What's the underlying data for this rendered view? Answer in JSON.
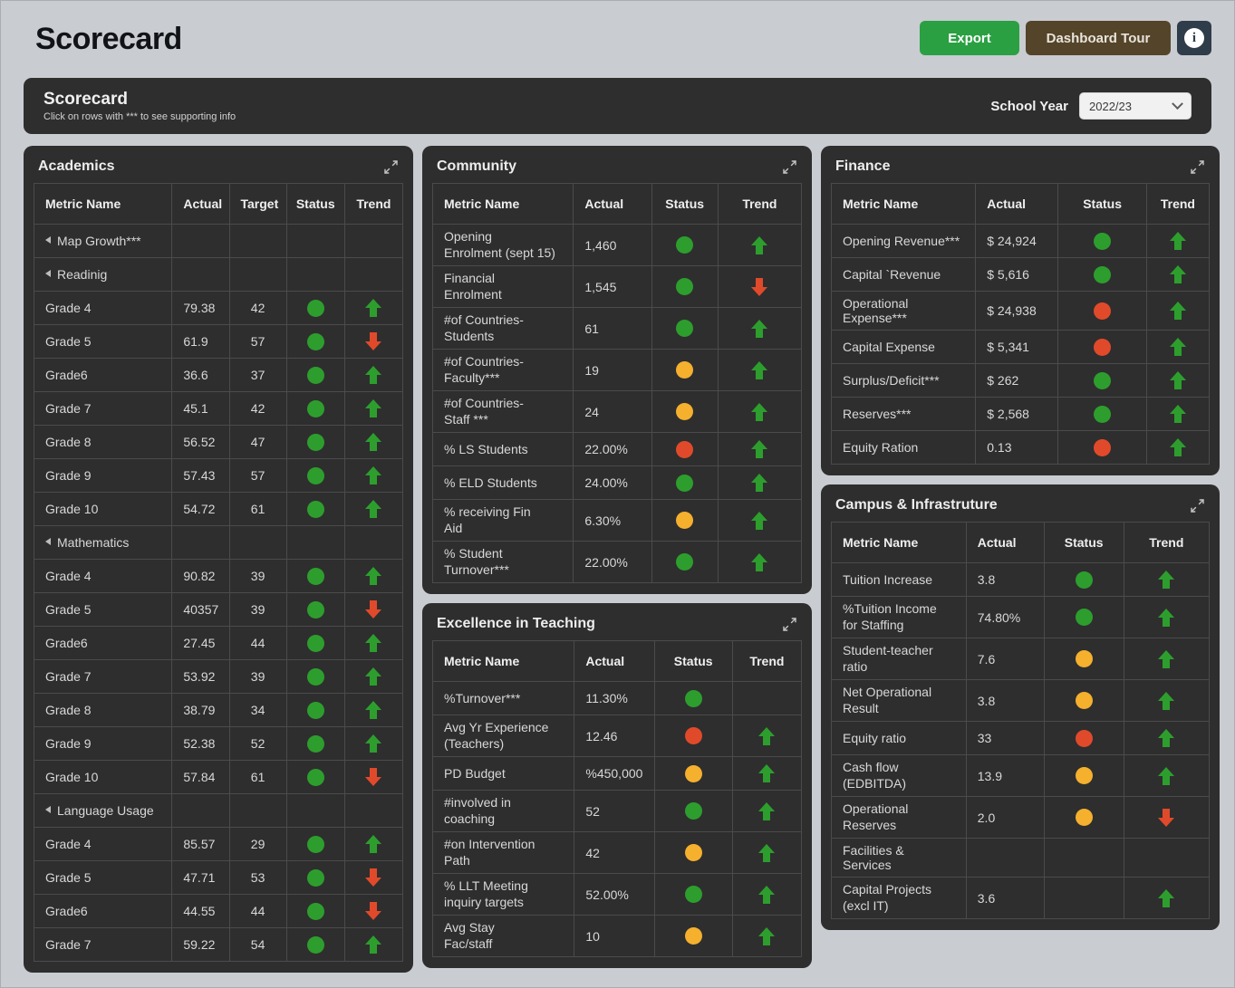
{
  "header": {
    "title": "Scorecard",
    "export_label": "Export",
    "tour_label": "Dashboard Tour",
    "info_icon": "info-icon",
    "info_glyph": "i"
  },
  "band": {
    "title": "Scorecard",
    "subtitle": "Click on rows with *** to see supporting info",
    "school_year_label": "School Year",
    "school_year_value": "2022/23",
    "chevron_icon": "chevron-down-icon"
  },
  "colors": {
    "green": "#2d9e2d",
    "amber": "#f5b02e",
    "red": "#e04a2a",
    "export_button": "#2aa042",
    "tour_button": "#54442a",
    "info_button": "#2f3c4a",
    "panel_bg": "#2e2e2e",
    "page_bg": "#c9ccd1"
  },
  "panels": {
    "academics": {
      "title": "Academics",
      "expand_icon": "expand-icon",
      "columns": [
        "Metric Name",
        "Actual",
        "Target",
        "Status",
        "Trend"
      ],
      "rows": [
        {
          "name": "Map Growth***",
          "level": 1,
          "group": true,
          "actual": "",
          "target": "",
          "status": "",
          "trend": ""
        },
        {
          "name": "Readinig",
          "level": 2,
          "group": true,
          "actual": "",
          "target": "",
          "status": "",
          "trend": ""
        },
        {
          "name": "Grade 4",
          "level": 3,
          "actual": "79.38",
          "target": "42",
          "status": "green",
          "trend": "up"
        },
        {
          "name": "Grade 5",
          "level": 3,
          "actual": "61.9",
          "target": "57",
          "status": "green",
          "trend": "down"
        },
        {
          "name": "Grade6",
          "level": 3,
          "actual": "36.6",
          "target": "37",
          "status": "green",
          "trend": "up"
        },
        {
          "name": "Grade 7",
          "level": 3,
          "actual": "45.1",
          "target": "42",
          "status": "green",
          "trend": "up"
        },
        {
          "name": "Grade 8",
          "level": 3,
          "actual": "56.52",
          "target": "47",
          "status": "green",
          "trend": "up"
        },
        {
          "name": "Grade 9",
          "level": 3,
          "actual": "57.43",
          "target": "57",
          "status": "green",
          "trend": "up"
        },
        {
          "name": "Grade 10",
          "level": 3,
          "actual": "54.72",
          "target": "61",
          "status": "green",
          "trend": "up"
        },
        {
          "name": "Mathematics",
          "level": 2,
          "group": true,
          "actual": "",
          "target": "",
          "status": "",
          "trend": ""
        },
        {
          "name": "Grade 4",
          "level": 3,
          "actual": "90.82",
          "target": "39",
          "status": "green",
          "trend": "up"
        },
        {
          "name": "Grade 5",
          "level": 3,
          "actual": "40357",
          "target": "39",
          "status": "green",
          "trend": "down"
        },
        {
          "name": "Grade6",
          "level": 3,
          "actual": "27.45",
          "target": "44",
          "status": "green",
          "trend": "up"
        },
        {
          "name": "Grade 7",
          "level": 3,
          "actual": "53.92",
          "target": "39",
          "status": "green",
          "trend": "up"
        },
        {
          "name": "Grade 8",
          "level": 3,
          "actual": "38.79",
          "target": "34",
          "status": "green",
          "trend": "up"
        },
        {
          "name": "Grade 9",
          "level": 3,
          "actual": "52.38",
          "target": "52",
          "status": "green",
          "trend": "up"
        },
        {
          "name": "Grade 10",
          "level": 3,
          "actual": "57.84",
          "target": "61",
          "status": "green",
          "trend": "down"
        },
        {
          "name": "Language Usage",
          "level": 2,
          "group": true,
          "actual": "",
          "target": "",
          "status": "",
          "trend": ""
        },
        {
          "name": "Grade 4",
          "level": 3,
          "actual": "85.57",
          "target": "29",
          "status": "green",
          "trend": "up"
        },
        {
          "name": "Grade 5",
          "level": 3,
          "actual": "47.71",
          "target": "53",
          "status": "green",
          "trend": "down"
        },
        {
          "name": "Grade6",
          "level": 3,
          "actual": "44.55",
          "target": "44",
          "status": "green",
          "trend": "down"
        },
        {
          "name": "Grade 7",
          "level": 3,
          "actual": "59.22",
          "target": "54",
          "status": "green",
          "trend": "up"
        }
      ]
    },
    "community": {
      "title": "Community",
      "expand_icon": "expand-icon",
      "columns": [
        "Metric Name",
        "Actual",
        "Status",
        "Trend"
      ],
      "rows": [
        {
          "name": "Opening\nEnrolment (sept 15)",
          "actual": "1,460",
          "status": "green",
          "trend": "up"
        },
        {
          "name": "Financial\nEnrolment",
          "actual": "1,545",
          "status": "green",
          "trend": "down"
        },
        {
          "name": "#of Countries-\nStudents",
          "actual": "61",
          "status": "green",
          "trend": "up"
        },
        {
          "name": "#of Countries-\nFaculty***",
          "actual": "19",
          "status": "amber",
          "trend": "up"
        },
        {
          "name": "#of Countries-\nStaff ***",
          "actual": "24",
          "status": "amber",
          "trend": "up"
        },
        {
          "name": "% LS Students",
          "actual": "22.00%",
          "status": "red",
          "trend": "up"
        },
        {
          "name": "%  ELD Students",
          "actual": "24.00%",
          "status": "green",
          "trend": "up"
        },
        {
          "name": "%  receiving Fin\nAid",
          "actual": "6.30%",
          "status": "amber",
          "trend": "up"
        },
        {
          "name": "%  Student\nTurnover***",
          "actual": "22.00%",
          "status": "green",
          "trend": "up"
        }
      ]
    },
    "finance": {
      "title": "Finance",
      "expand_icon": "expand-icon",
      "columns": [
        "Metric Name",
        "Actual",
        "Status",
        "Trend"
      ],
      "rows": [
        {
          "name": "Opening Revenue***",
          "actual": "$ 24,924",
          "status": "green",
          "trend": "up"
        },
        {
          "name": "Capital `Revenue",
          "actual": "$ 5,616",
          "status": "green",
          "trend": "up"
        },
        {
          "name": "Operational Expense***",
          "actual": "$ 24,938",
          "status": "red",
          "trend": "up"
        },
        {
          "name": "Capital Expense",
          "actual": "$ 5,341",
          "status": "red",
          "trend": "up"
        },
        {
          "name": "Surplus/Deficit***",
          "actual": "$ 262",
          "status": "green",
          "trend": "up"
        },
        {
          "name": "Reserves***",
          "actual": "$ 2,568",
          "status": "green",
          "trend": "up"
        },
        {
          "name": "Equity Ration",
          "actual": "0.13",
          "status": "red",
          "trend": "up"
        }
      ]
    },
    "teaching": {
      "title": "Excellence in Teaching",
      "expand_icon": "expand-icon",
      "columns": [
        "Metric Name",
        "Actual",
        "Status",
        "Trend"
      ],
      "rows": [
        {
          "name": "%Turnover***",
          "actual": "11.30%",
          "status": "green",
          "trend": ""
        },
        {
          "name": "Avg Yr Experience\n(Teachers)",
          "actual": "12.46",
          "status": "red",
          "trend": "up"
        },
        {
          "name": "PD Budget",
          "actual": "%450,000",
          "status": "amber",
          "trend": "up"
        },
        {
          "name": "#involved in\ncoaching",
          "actual": "52",
          "status": "green",
          "trend": "up"
        },
        {
          "name": "#on Intervention\nPath",
          "actual": "42",
          "status": "amber",
          "trend": "up"
        },
        {
          "name": "% LLT Meeting\ninquiry targets",
          "actual": "52.00%",
          "status": "green",
          "trend": "up"
        },
        {
          "name": "Avg Stay\nFac/staff",
          "actual": "10",
          "status": "amber",
          "trend": "up"
        }
      ]
    },
    "campus": {
      "title": "Campus & Infrastruture",
      "expand_icon": "expand-icon",
      "columns": [
        "Metric Name",
        "Actual",
        "Status",
        "Trend"
      ],
      "rows": [
        {
          "name": "Tuition Increase",
          "actual": "3.8",
          "status": "green",
          "trend": "up"
        },
        {
          "name": "%Tuition Income\nfor Staffing",
          "actual": "74.80%",
          "status": "green",
          "trend": "up"
        },
        {
          "name": "Student-teacher\nratio",
          "actual": "7.6",
          "status": "amber",
          "trend": "up"
        },
        {
          "name": "Net Operational\nResult",
          "actual": "3.8",
          "status": "amber",
          "trend": "up"
        },
        {
          "name": "Equity ratio",
          "actual": "33",
          "status": "red",
          "trend": "up"
        },
        {
          "name": "Cash flow\n(EDBITDA)",
          "actual": "13.9",
          "status": "amber",
          "trend": "up"
        },
        {
          "name": "Operational\nReserves",
          "actual": "2.0",
          "status": "amber",
          "trend": "down"
        },
        {
          "name": "Facilities & Services",
          "actual": "",
          "status": "",
          "trend": ""
        },
        {
          "name": "Capital Projects\n(excl IT)",
          "actual": "3.6",
          "status": "",
          "trend": "up"
        }
      ]
    }
  }
}
